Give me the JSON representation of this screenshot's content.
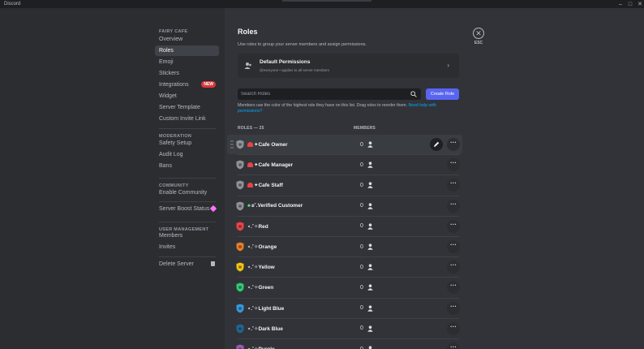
{
  "window": {
    "title": "Discord"
  },
  "sidebar": {
    "sections": [
      {
        "header": "FAIRY CAFE",
        "items": [
          {
            "label": "Overview"
          },
          {
            "label": "Roles",
            "active": true
          },
          {
            "label": "Emoji"
          },
          {
            "label": "Stickers"
          },
          {
            "label": "Integrations",
            "badge": "NEW"
          },
          {
            "label": "Widget"
          },
          {
            "label": "Server Template"
          },
          {
            "label": "Custom Invite Link"
          }
        ]
      },
      {
        "header": "MODERATION",
        "items": [
          {
            "label": "Safety Setup"
          },
          {
            "label": "Audit Log"
          },
          {
            "label": "Bans"
          }
        ]
      },
      {
        "header": "COMMUNITY",
        "items": [
          {
            "label": "Enable Community"
          }
        ]
      },
      {
        "header": "",
        "items": [
          {
            "label": "Server Boost Status",
            "icon": "boost-icon"
          }
        ]
      },
      {
        "header": "USER MANAGEMENT",
        "items": [
          {
            "label": "Members"
          },
          {
            "label": "Invites"
          }
        ]
      },
      {
        "header": "",
        "items": [
          {
            "label": "Delete Server",
            "icon": "trash-icon"
          }
        ]
      }
    ]
  },
  "main": {
    "title": "Roles",
    "description": "Use roles to group your server members and assign permissions.",
    "default_permissions": {
      "title": "Default Permissions",
      "subtitle": "@everyone • applies to all server members"
    },
    "esc_label": "ESC",
    "search_placeholder": "Search Roles",
    "create_role_label": "Create Role",
    "help_text": "Members use the color of the highest role they have on this list. Drag roles to reorder them.",
    "help_link": "Need help with permissions?",
    "roles_header": "ROLES — 25",
    "members_header": "MEMBERS",
    "roles": [
      {
        "name": "✦Cafe Owner",
        "prefix": "mushroom-icon",
        "count": "0",
        "color": "#8e9297"
      },
      {
        "name": "✦Cafe Manager",
        "prefix": "mushroom-icon",
        "count": "0",
        "color": "#8e9297"
      },
      {
        "name": "✦Cafe Staff",
        "prefix": "mushroom-icon",
        "count": "0",
        "color": "#8e9297"
      },
      {
        "name": "ʚ˚.Verified Customer",
        "prefix": "clover-icon",
        "count": "0",
        "color": "#8e9297"
      },
      {
        "name": "⋆.˚✧Red",
        "prefix": "",
        "count": "0",
        "color": "#ed4245"
      },
      {
        "name": "⋆.˚✧Orange",
        "prefix": "",
        "count": "0",
        "color": "#e67e22"
      },
      {
        "name": "⋆.˚✧Yellow",
        "prefix": "",
        "count": "0",
        "color": "#f1c40f"
      },
      {
        "name": "⋆.˚✧Green",
        "prefix": "",
        "count": "0",
        "color": "#2ecc71"
      },
      {
        "name": "⋆.˚✧Light Blue",
        "prefix": "",
        "count": "0",
        "color": "#3498db"
      },
      {
        "name": "⋆.˚✧Dark Blue",
        "prefix": "",
        "count": "0",
        "color": "#206694"
      },
      {
        "name": "⋆.˚✧Purple",
        "prefix": "",
        "count": "0",
        "color": "#9b59b6"
      }
    ]
  },
  "colors": {
    "accent": "#5865f2",
    "badge_new": "#da373c",
    "link": "#00a8fc"
  }
}
